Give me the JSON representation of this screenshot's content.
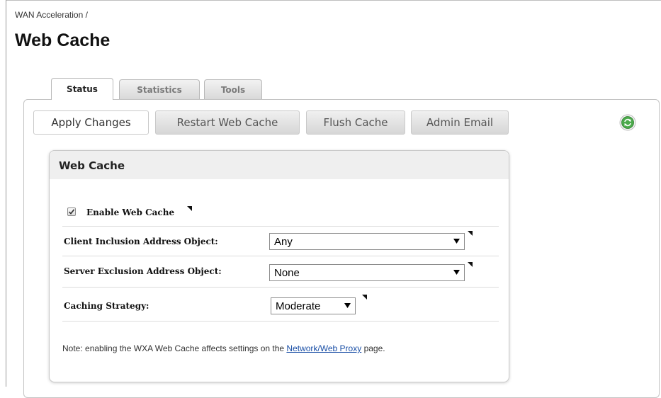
{
  "breadcrumb": "WAN Acceleration /",
  "page_title": "Web Cache",
  "tabs": [
    {
      "label": "Status",
      "active": true
    },
    {
      "label": "Statistics",
      "active": false
    },
    {
      "label": "Tools",
      "active": false
    }
  ],
  "toolbar": {
    "apply": "Apply Changes",
    "restart": "Restart Web Cache",
    "flush": "Flush Cache",
    "admin_email": "Admin Email",
    "refresh_icon": "refresh-icon"
  },
  "section": {
    "title": "Web Cache",
    "enable": {
      "label": "Enable Web Cache",
      "checked": true
    },
    "client_inclusion": {
      "label": "Client Inclusion Address Object:",
      "value": "Any"
    },
    "server_exclusion": {
      "label": "Server Exclusion Address Object:",
      "value": "None"
    },
    "caching_strategy": {
      "label": "Caching Strategy:",
      "value": "Moderate"
    },
    "note_prefix": "Note: enabling the WXA Web Cache affects settings on the ",
    "note_link": "Network/Web Proxy",
    "note_suffix": " page."
  },
  "colors": {
    "link": "#1a4fa6",
    "refresh_green": "#3b9a3b"
  }
}
